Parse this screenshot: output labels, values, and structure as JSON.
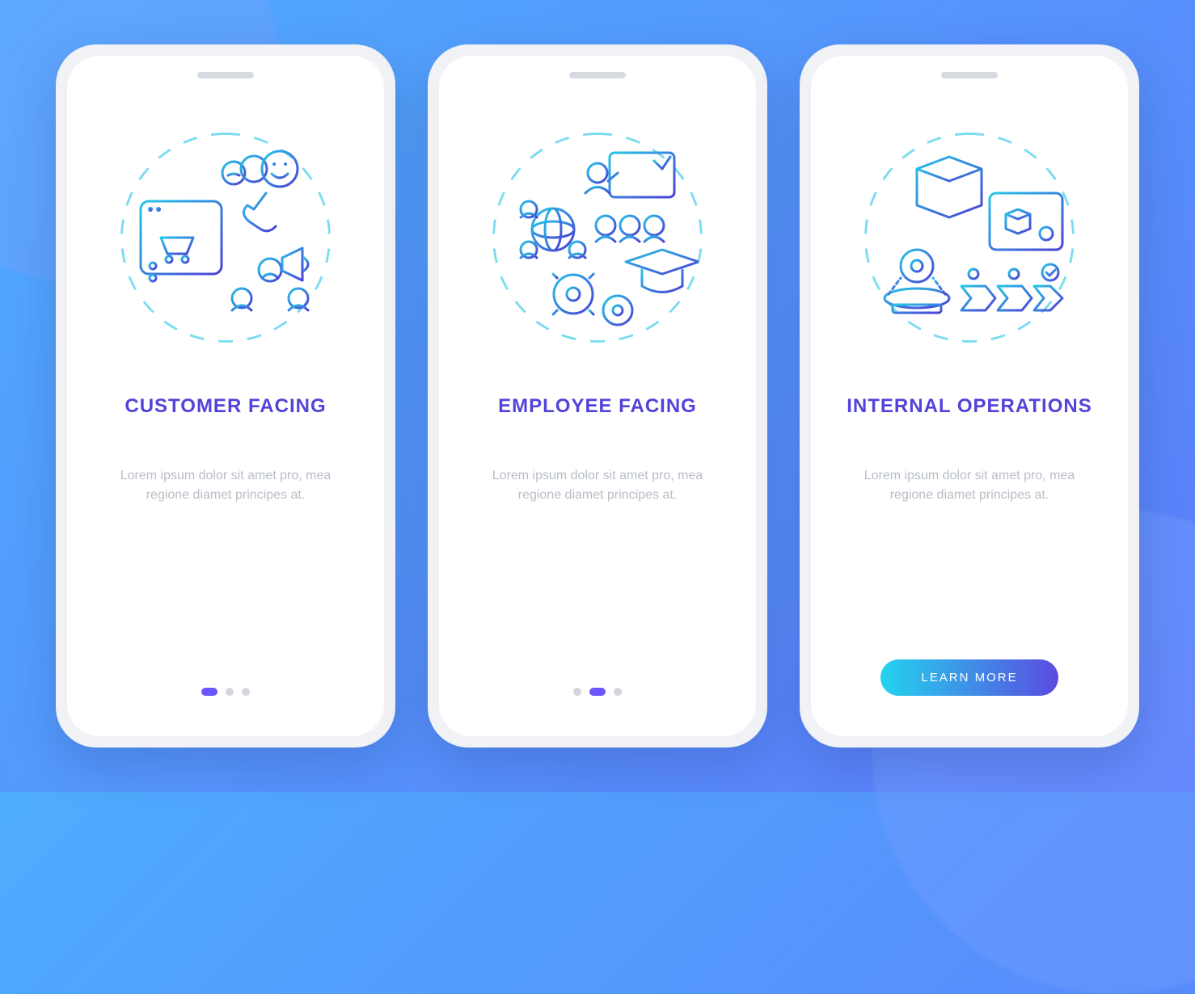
{
  "colors": {
    "accent_gradient_start": "#23d3ee",
    "accent_gradient_end": "#5b4be0",
    "title": "#5243d9",
    "body": "#b8bdc7",
    "dot_inactive": "#d3d6dd",
    "dot_active": "#6a55ff"
  },
  "screens": [
    {
      "title": "CUSTOMER FACING",
      "body": "Lorem ipsum dolor sit amet pro, mea regione diamet principes at.",
      "illustration_name": "customer-facing-icon",
      "page_indicator": {
        "total": 3,
        "active_index": 0
      }
    },
    {
      "title": "EMPLOYEE FACING",
      "body": "Lorem ipsum dolor sit amet pro, mea regione diamet principes at.",
      "illustration_name": "employee-facing-icon",
      "page_indicator": {
        "total": 3,
        "active_index": 1
      }
    },
    {
      "title": "INTERNAL OPERATIONS",
      "body": "Lorem ipsum dolor sit amet pro, mea regione diamet principes at.",
      "illustration_name": "internal-operations-icon",
      "cta_label": "LEARN MORE"
    }
  ]
}
